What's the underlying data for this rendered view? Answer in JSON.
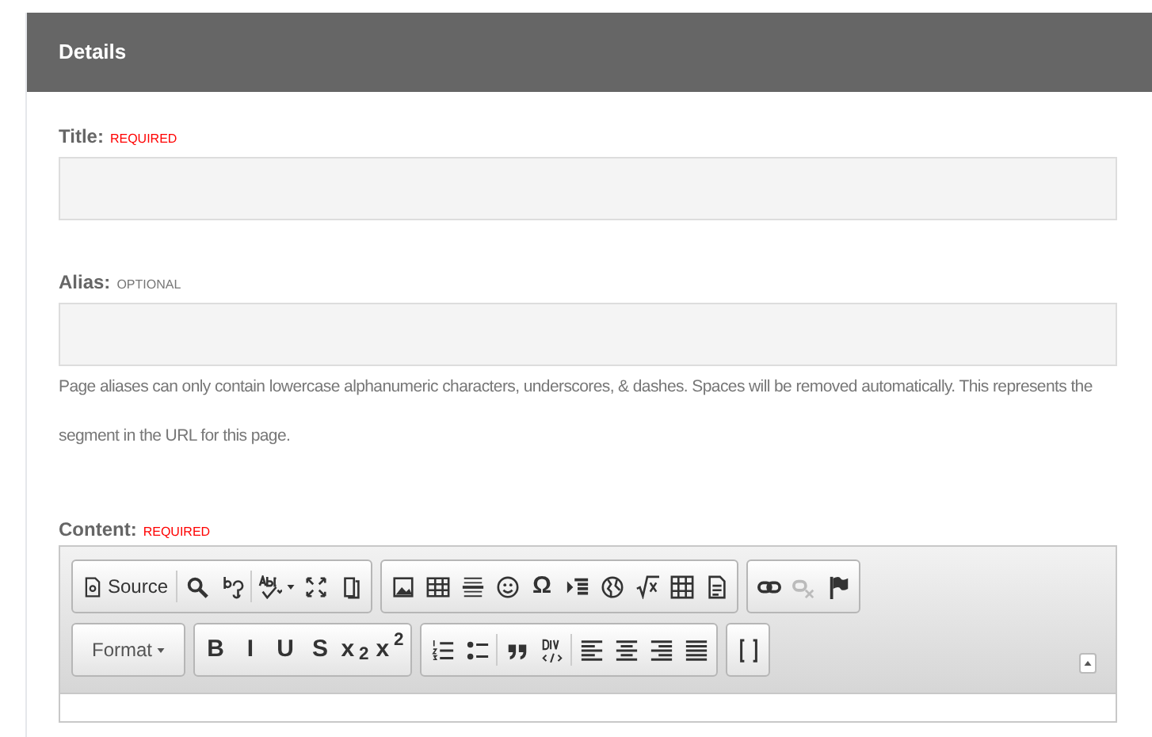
{
  "panel": {
    "title": "Details"
  },
  "fields": [
    {
      "label": "Title:",
      "tag": "REQUIRED",
      "required": true
    },
    {
      "label": "Alias:",
      "tag": "OPTIONAL",
      "required": false,
      "help": "Page aliases can only contain lowercase alphanumeric characters, underscores, & dashes. Spaces will be removed automatically. This represents the segment in the URL for this page."
    }
  ],
  "content": {
    "label": "Content:",
    "tag": "REQUIRED",
    "required": true,
    "toolbar": [
      [
        {
          "sections": [
            [
              {
                "kind": "source",
                "label": "Source",
                "disabled": false
              }
            ],
            [
              {
                "kind": "find",
                "disabled": false
              },
              {
                "kind": "replace",
                "disabled": false
              }
            ],
            [
              {
                "kind": "spellcheck",
                "disabled": false
              },
              {
                "kind": "maximize",
                "disabled": false
              },
              {
                "kind": "blocks",
                "disabled": false
              }
            ]
          ]
        },
        {
          "sections": [
            [
              {
                "kind": "image",
                "disabled": false
              },
              {
                "kind": "table",
                "disabled": false
              },
              {
                "kind": "rule",
                "disabled": false
              },
              {
                "kind": "smiley",
                "disabled": false
              },
              {
                "kind": "glyph",
                "glyph": "Ω",
                "disabled": false
              },
              {
                "kind": "indent",
                "disabled": false
              },
              {
                "kind": "globe",
                "disabled": false
              },
              {
                "kind": "sqrt",
                "disabled": false
              },
              {
                "kind": "grid",
                "disabled": false
              },
              {
                "kind": "document",
                "disabled": false
              }
            ]
          ]
        },
        {
          "sections": [
            [
              {
                "kind": "link",
                "disabled": false
              },
              {
                "kind": "unlink",
                "disabled": true
              },
              {
                "kind": "flag",
                "disabled": false
              }
            ]
          ]
        }
      ],
      [
        {
          "sections": [
            [
              {
                "kind": "combo",
                "label": "Format",
                "disabled": false
              }
            ]
          ]
        },
        {
          "sections": [
            [
              {
                "kind": "glyph",
                "glyph": "B",
                "disabled": false
              },
              {
                "kind": "glyph",
                "glyph": "I",
                "disabled": false
              },
              {
                "kind": "glyph",
                "glyph": "U",
                "disabled": false
              },
              {
                "kind": "glyph",
                "glyph": "S",
                "disabled": false
              },
              {
                "kind": "glyph",
                "glyph": "x$_{2}$",
                "disabled": false
              },
              {
                "kind": "glyph",
                "glyph": "x$^{2}$",
                "disabled": false
              }
            ]
          ]
        },
        {
          "sections": [
            [
              {
                "kind": "numbered",
                "disabled": false
              },
              {
                "kind": "bulleted",
                "disabled": false
              }
            ],
            [
              {
                "kind": "quote",
                "disabled": false
              },
              {
                "kind": "div",
                "disabled": false
              }
            ],
            [
              {
                "kind": "align-left",
                "disabled": false
              },
              {
                "kind": "align-center",
                "disabled": false
              },
              {
                "kind": "align-right",
                "disabled": false
              },
              {
                "kind": "justify",
                "disabled": false
              }
            ]
          ]
        },
        {
          "sections": [
            [
              {
                "kind": "brackets",
                "disabled": false
              }
            ]
          ]
        }
      ]
    ]
  }
}
